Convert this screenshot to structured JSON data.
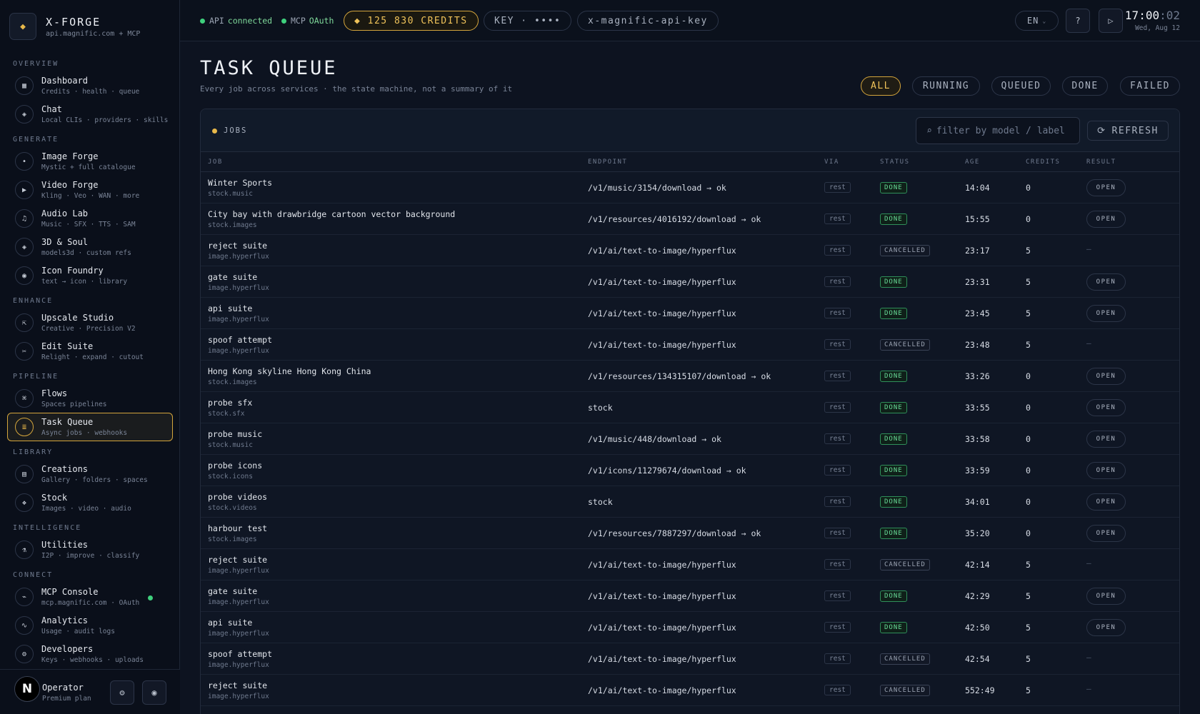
{
  "brand": {
    "title": "X-FORGE",
    "subtitle": "api.magnific.com + MCP",
    "icon": "diamond-icon"
  },
  "nav": {
    "overview": "OVERVIEW",
    "generate": "GENERATE",
    "enhance": "ENHANCE",
    "pipeline": "PIPELINE",
    "library": "LIBRARY",
    "intelligence": "INTELLIGENCE",
    "connect": "CONNECT",
    "items": [
      {
        "label": "Dashboard",
        "desc": "Credits · health · queue",
        "icon": "dashboard-icon",
        "glyph": "▦"
      },
      {
        "label": "Chat",
        "desc": "Local CLIs · providers · skills",
        "icon": "chat-icon",
        "glyph": "◈"
      },
      {
        "label": "Image Forge",
        "desc": "Mystic + full catalogue",
        "icon": "image-icon",
        "glyph": "•"
      },
      {
        "label": "Video Forge",
        "desc": "Kling · Veo · WAN · more",
        "icon": "play-icon",
        "glyph": "▶"
      },
      {
        "label": "Audio Lab",
        "desc": "Music · SFX · TTS · SAM",
        "icon": "music-icon",
        "glyph": "♫"
      },
      {
        "label": "3D & Soul",
        "desc": "models3d · custom refs",
        "icon": "cube-icon",
        "glyph": "◈"
      },
      {
        "label": "Icon Foundry",
        "desc": "text → icon · library",
        "icon": "target-icon",
        "glyph": "◉"
      },
      {
        "label": "Upscale Studio",
        "desc": "Creative · Precision V2",
        "icon": "upscale-icon",
        "glyph": "⇱"
      },
      {
        "label": "Edit Suite",
        "desc": "Relight · expand · cutout",
        "icon": "scissors-icon",
        "glyph": "✂"
      },
      {
        "label": "Flows",
        "desc": "Spaces pipelines",
        "icon": "flows-icon",
        "glyph": "⌘"
      },
      {
        "label": "Task Queue",
        "desc": "Async jobs · webhooks",
        "icon": "queue-icon",
        "glyph": "≣"
      },
      {
        "label": "Creations",
        "desc": "Gallery · folders · spaces",
        "icon": "gallery-icon",
        "glyph": "▤"
      },
      {
        "label": "Stock",
        "desc": "Images · video · audio",
        "icon": "stock-icon",
        "glyph": "❖"
      },
      {
        "label": "Utilities",
        "desc": "I2P · improve · classify",
        "icon": "flask-icon",
        "glyph": "⚗"
      },
      {
        "label": "MCP Console",
        "desc": "mcp.magnific.com · OAuth",
        "icon": "console-icon",
        "glyph": "⌁"
      },
      {
        "label": "Analytics",
        "desc": "Usage · audit logs",
        "icon": "analytics-icon",
        "glyph": "∿"
      },
      {
        "label": "Developers",
        "desc": "Keys · webhooks · uploads",
        "icon": "gear-icon",
        "glyph": "⚙"
      }
    ]
  },
  "footer": {
    "avatar": "N",
    "name": "Operator",
    "plan": "Premium plan",
    "settings_glyph": "⚙",
    "theme_glyph": "◉"
  },
  "topbar": {
    "api_label": "API",
    "api_state": "connected",
    "mcp_label": "MCP",
    "mcp_state": "OAuth",
    "credits": "◆ 125 830 CREDITS",
    "key": "KEY · ••••",
    "key_header": "x-magnific-api-key",
    "lang": "EN",
    "help_glyph": "?",
    "play_glyph": "▷",
    "time_hm": "17:00",
    "time_s": ":02",
    "date": "Wed, Aug 12"
  },
  "page": {
    "title": "TASK QUEUE",
    "subtitle": "Every job across services · the state machine, not a summary of it",
    "filters": [
      "ALL",
      "RUNNING",
      "QUEUED",
      "DONE",
      "FAILED"
    ]
  },
  "panel": {
    "title": "JOBS",
    "search_placeholder": "filter by model / label",
    "search_glyph": "⌕",
    "refresh_glyph": "⟳",
    "refresh": "REFRESH",
    "columns": [
      "JOB",
      "ENDPOINT",
      "VIA",
      "STATUS",
      "AGE",
      "CREDITS",
      "RESULT"
    ],
    "open_label": "OPEN",
    "dash": "—"
  },
  "jobs": [
    {
      "name": "Winter Sports",
      "source": "stock.music",
      "endpoint": "/v1/music/3154/download → ok",
      "via": "rest",
      "status": "DONE",
      "age": "14:04",
      "credits": "0"
    },
    {
      "name": "City bay with drawbridge cartoon vector background",
      "source": "stock.images",
      "endpoint": "/v1/resources/4016192/download → ok",
      "via": "rest",
      "status": "DONE",
      "age": "15:55",
      "credits": "0"
    },
    {
      "name": "reject suite",
      "source": "image.hyperflux",
      "endpoint": "/v1/ai/text-to-image/hyperflux",
      "via": "rest",
      "status": "CANCELLED",
      "age": "23:17",
      "credits": "5"
    },
    {
      "name": "gate suite",
      "source": "image.hyperflux",
      "endpoint": "/v1/ai/text-to-image/hyperflux",
      "via": "rest",
      "status": "DONE",
      "age": "23:31",
      "credits": "5"
    },
    {
      "name": "api suite",
      "source": "image.hyperflux",
      "endpoint": "/v1/ai/text-to-image/hyperflux",
      "via": "rest",
      "status": "DONE",
      "age": "23:45",
      "credits": "5"
    },
    {
      "name": "spoof attempt",
      "source": "image.hyperflux",
      "endpoint": "/v1/ai/text-to-image/hyperflux",
      "via": "rest",
      "status": "CANCELLED",
      "age": "23:48",
      "credits": "5"
    },
    {
      "name": "Hong Kong skyline Hong Kong China",
      "source": "stock.images",
      "endpoint": "/v1/resources/134315107/download → ok",
      "via": "rest",
      "status": "DONE",
      "age": "33:26",
      "credits": "0"
    },
    {
      "name": "probe sfx",
      "source": "stock.sfx",
      "endpoint": "stock",
      "via": "rest",
      "status": "DONE",
      "age": "33:55",
      "credits": "0"
    },
    {
      "name": "probe music",
      "source": "stock.music",
      "endpoint": "/v1/music/448/download → ok",
      "via": "rest",
      "status": "DONE",
      "age": "33:58",
      "credits": "0"
    },
    {
      "name": "probe icons",
      "source": "stock.icons",
      "endpoint": "/v1/icons/11279674/download → ok",
      "via": "rest",
      "status": "DONE",
      "age": "33:59",
      "credits": "0"
    },
    {
      "name": "probe videos",
      "source": "stock.videos",
      "endpoint": "stock",
      "via": "rest",
      "status": "DONE",
      "age": "34:01",
      "credits": "0"
    },
    {
      "name": "harbour test",
      "source": "stock.images",
      "endpoint": "/v1/resources/7887297/download → ok",
      "via": "rest",
      "status": "DONE",
      "age": "35:20",
      "credits": "0"
    },
    {
      "name": "reject suite",
      "source": "image.hyperflux",
      "endpoint": "/v1/ai/text-to-image/hyperflux",
      "via": "rest",
      "status": "CANCELLED",
      "age": "42:14",
      "credits": "5"
    },
    {
      "name": "gate suite",
      "source": "image.hyperflux",
      "endpoint": "/v1/ai/text-to-image/hyperflux",
      "via": "rest",
      "status": "DONE",
      "age": "42:29",
      "credits": "5"
    },
    {
      "name": "api suite",
      "source": "image.hyperflux",
      "endpoint": "/v1/ai/text-to-image/hyperflux",
      "via": "rest",
      "status": "DONE",
      "age": "42:50",
      "credits": "5"
    },
    {
      "name": "spoof attempt",
      "source": "image.hyperflux",
      "endpoint": "/v1/ai/text-to-image/hyperflux",
      "via": "rest",
      "status": "CANCELLED",
      "age": "42:54",
      "credits": "5"
    },
    {
      "name": "reject suite",
      "source": "image.hyperflux",
      "endpoint": "/v1/ai/text-to-image/hyperflux",
      "via": "rest",
      "status": "CANCELLED",
      "age": "552:49",
      "credits": "5"
    }
  ],
  "colors": {
    "accent": "#e8b84a",
    "ok": "#3fd07d",
    "done": "#68dc98",
    "bg": "#0d1320"
  }
}
